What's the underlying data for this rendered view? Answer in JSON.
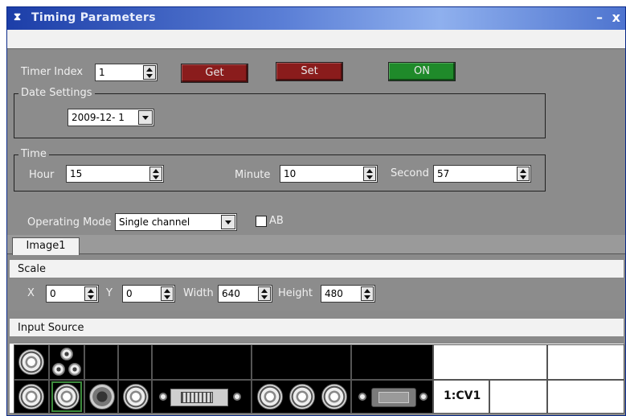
{
  "window": {
    "title": "Timing Parameters",
    "title_icon": "app-icon",
    "minimize": "–",
    "close": "x"
  },
  "timer": {
    "label": "Timer Index",
    "value": "1"
  },
  "buttons": {
    "get": "Get",
    "set": "Set",
    "on": "ON"
  },
  "colors": {
    "get": "#8a1c1c",
    "set": "#8a1c1c",
    "on": "#1f8a2a",
    "titlebar": "#1c3ea8"
  },
  "date": {
    "legend": "Date Settings",
    "value": "2009-12- 1"
  },
  "time": {
    "legend": "Time",
    "hour_label": "Hour",
    "hour": "15",
    "minute_label": "Minute",
    "minute": "10",
    "second_label": "Second",
    "second": "57"
  },
  "mode": {
    "label": "Operating Mode",
    "value": "Single channel",
    "checkbox_label": "AB",
    "checkbox_checked": false
  },
  "tabs": [
    {
      "label": "Image1",
      "selected": true
    }
  ],
  "scale": {
    "header": "Scale",
    "x_label": "X",
    "x": "0",
    "y_label": "Y",
    "y": "0",
    "width_label": "Width",
    "width": "640",
    "height_label": "Height",
    "height": "480"
  },
  "input_source": {
    "header": "Input Source",
    "selected_label": "1:CV1"
  }
}
